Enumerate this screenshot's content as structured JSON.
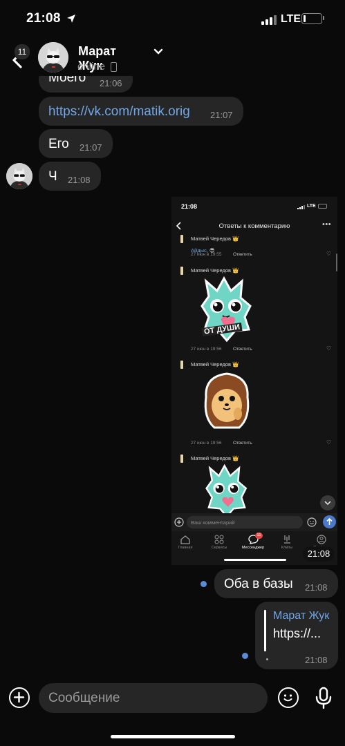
{
  "status_bar": {
    "time": "21:08",
    "network": "LTE"
  },
  "header": {
    "back_badge": "11",
    "contact_name": "Марат Жук",
    "presence": "online"
  },
  "messages": [
    {
      "id": "m1",
      "text": "Моего",
      "time": "21:06",
      "direction": "in"
    },
    {
      "id": "m2",
      "text": "https://vk.com/matik.orig",
      "time": "21:07",
      "direction": "in",
      "is_link": true
    },
    {
      "id": "m3",
      "text": "Его",
      "time": "21:07",
      "direction": "in"
    },
    {
      "id": "m4",
      "text": "Ч",
      "time": "21:08",
      "direction": "in"
    }
  ],
  "screenshot_message": {
    "time": "21:08",
    "inner": {
      "status_time": "21:08",
      "status_network": "LTE",
      "title": "Ответы к комментарию",
      "comments": [
        {
          "author": "Матвей Чередов 👑",
          "text_mention": "Айдыс",
          "text_rest": ", 😎",
          "meta": "27 июн в 19:55",
          "reply": "Ответить"
        },
        {
          "author": "Матвей Чередов 👑",
          "sticker_text": "ОТ ДУШИ",
          "meta": "27 июн в 19:56",
          "reply": "Ответить"
        },
        {
          "author": "Матвей Чередов 👑",
          "meta": "27 июн в 19:56",
          "reply": "Ответить"
        },
        {
          "author": "Матвей Чередов 👑"
        }
      ],
      "input_placeholder": "Ваш комментарий",
      "tabs": [
        {
          "label": "Главная"
        },
        {
          "label": "Сервисы"
        },
        {
          "label": "Мессенджер",
          "badge": "11"
        },
        {
          "label": "Клипы"
        },
        {
          "label": "Профиль"
        }
      ]
    }
  },
  "outgoing": [
    {
      "text": "Оба в базы",
      "time": "21:08"
    },
    {
      "reply_author": "Марат Жук",
      "reply_text": "https://...",
      "time": "21:08"
    }
  ],
  "composer": {
    "placeholder": "Сообщение"
  }
}
